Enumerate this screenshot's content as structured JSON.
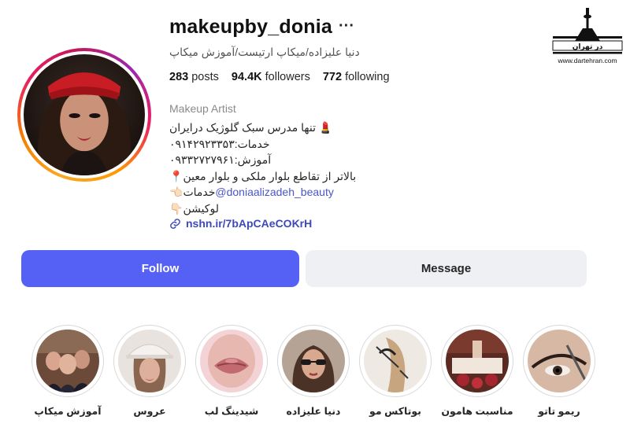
{
  "profile": {
    "username": "makeupby_donia",
    "full_name": "دنیا علیزاده/میکاپ ارتیست/آموزش میکاپ",
    "posts_count": "283",
    "posts_label": "posts",
    "followers_count": "94.4K",
    "followers_label": "followers",
    "following_count": "772",
    "following_label": "following",
    "category": "Makeup Artist",
    "bio": {
      "line1": "تنها مدرس سبک گلوژیک درایران 💄",
      "line2": "خدمات:۰۹۱۴۲۹۲۳۳۵۳",
      "line3": "آموزش:۰۹۳۳۲۷۲۷۹۶۱",
      "line4": "📍بالاتر از تقاطع بلوار ملکی و بلوار معین",
      "line5_text": "👈🏻خدمات",
      "line5_mention": "@doniaalizadeh_beauty",
      "line6": "👇🏻لوکیشن"
    },
    "link": "nshn.ir/7bApCAeCOKrH"
  },
  "actions": {
    "follow_label": "Follow",
    "message_label": "Message"
  },
  "highlights": [
    {
      "label": "آموزش میکاپ"
    },
    {
      "label": "عروس"
    },
    {
      "label": "شیدینگ لب"
    },
    {
      "label": "دنیا علیزاده"
    },
    {
      "label": "بوتاکس مو"
    },
    {
      "label": "مناسبت هامون"
    },
    {
      "label": "ریمو تاتو"
    }
  ],
  "watermark": {
    "brand_text": "در تهران",
    "url": "www.dartehran.com"
  },
  "icons": {
    "more": "more-options-icon",
    "link": "link-icon"
  },
  "colors": {
    "follow_button": "#5561f5",
    "message_button": "#eff0f3",
    "link": "#3d49b8"
  }
}
